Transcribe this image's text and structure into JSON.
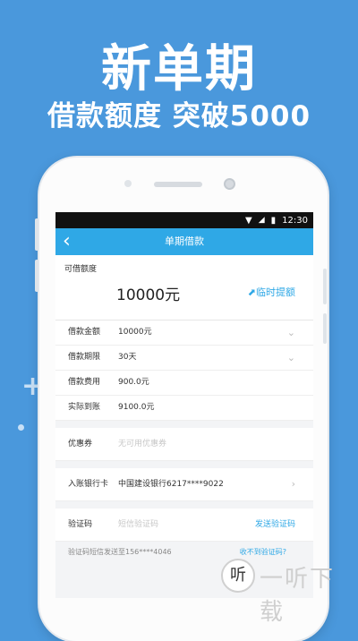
{
  "promo": {
    "headline": "新单期",
    "subline": "借款额度  突破5000"
  },
  "status_bar": {
    "time": "12:30"
  },
  "nav": {
    "back_icon": "‹",
    "title": "单期借款"
  },
  "quota": {
    "label": "可借额度",
    "amount": "10000元",
    "raise_link": "临时提额"
  },
  "loan_rows": [
    {
      "label": "借款金额",
      "value": "10000元"
    },
    {
      "label": "借款期限",
      "value": "30天"
    },
    {
      "label": "借款费用",
      "value": "900.0元"
    },
    {
      "label": "实际到账",
      "value": "9100.0元"
    }
  ],
  "coupon": {
    "label": "优惠券",
    "placeholder": "无可用优惠券"
  },
  "bank": {
    "label": "入账银行卡",
    "value": "中国建设银行6217****9022"
  },
  "verify": {
    "label": "验证码",
    "placeholder": "短信验证码",
    "send_link": "发送验证码"
  },
  "sms_hint": {
    "text": "验证码短信发送至156****4046",
    "help_link": "收不到验证码?"
  },
  "watermark": {
    "icon_text": "听",
    "text": "一听下载"
  }
}
